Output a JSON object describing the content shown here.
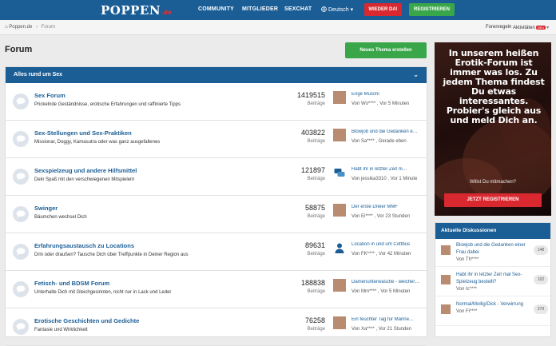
{
  "header": {
    "logo": "POPPEN",
    "logo_tld": ".de",
    "nav": [
      "COMMUNITY",
      "MITGLIEDER",
      "SEXCHAT"
    ],
    "language": "Deutsch",
    "login_label": "WIEDER DA!",
    "register_label": "REGISTRIEREN"
  },
  "breadcrumb": {
    "home": "Poppen.de",
    "current": "Forum"
  },
  "topright": {
    "rules": "Forenregeln",
    "activity": "Aktivitäten",
    "activity_badge": "NEU"
  },
  "page": {
    "title": "Forum",
    "new_thread_label": "Neues Thema erstellen"
  },
  "section": {
    "title": "Alles rund um Sex",
    "count_label": "Beiträge",
    "rows": [
      {
        "name": "Sex Forum",
        "desc": "Prickelnde Geständnisse, erotische Erfahrungen und raffinierte Tipps",
        "count": "1419515",
        "last_title": "Enge Muschi",
        "last_meta": "Von Wo**** , Vor 5 Minuten"
      },
      {
        "name": "Sex-Stellungen und Sex-Praktiken",
        "desc": "Missionar, Doggy, Kamasutra oder was ganz ausgefallenes",
        "count": "403822",
        "last_title": "Blowjob und die Gedanken e…",
        "last_meta": "Von Sa**** , Gerade eben"
      },
      {
        "name": "Sexspielzeug und andere Hilfsmittel",
        "desc": "Dein Spaß mit den verschwiegenen Mitspielern",
        "count": "121897",
        "last_title": "Habt ihr in letzter Zeit m…",
        "last_meta": "Von jessika3310 , Vor 1 Minute"
      },
      {
        "name": "Swinger",
        "desc": "Bäumchen wechsel Dich",
        "count": "58875",
        "last_title": "Der erste Dreier MMF",
        "last_meta": "Von Ei**** , Vor 23 Stunden"
      },
      {
        "name": "Erfahrungsaustausch zu Locations",
        "desc": "Drin oder draußen? Tausche Dich über Treffpunkte in Deiner Region aus",
        "count": "89631",
        "last_title": "Location in und um Cottbus",
        "last_meta": "Von FK**** , Vor 42 Minuten"
      },
      {
        "name": "Fetisch- und BDSM Forum",
        "desc": "Unterhalte Dich mit Gleichgesinnten, nicht nur in Lack und Leder",
        "count": "188838",
        "last_title": "Damenunterwäsche - welcher…",
        "last_meta": "Von Mm**** , Vor 5 Minuten"
      },
      {
        "name": "Erotische Geschichten und Gedichte",
        "desc": "Fantasie und Wirklichkeit",
        "count": "76258",
        "last_title": "Ein feuchter Tag für Männe…",
        "last_meta": "Von Xa**** , Vor 21 Stunden"
      }
    ]
  },
  "ad": {
    "headline": "In unserem heißen Erotik-Forum ist immer was los. Zu jedem Thema findest Du etwas interessantes. Probier's gleich aus und meld Dich an.",
    "question": "Willst Du mitmachen?",
    "cta": "JETZT REGISTRIEREN"
  },
  "sidebar": {
    "title": "Aktuelle Diskussionen",
    "items": [
      {
        "title": "Blowjob und die Gedanken einer Frau dabei",
        "meta": "Von Th****",
        "count": "148"
      },
      {
        "title": "Habt ihr in letzter Zeit mal Sex-Spielzeug bestellt?",
        "meta": "Von Ic****",
        "count": "102"
      },
      {
        "title": "Normal/Mollig/Dick - Verwirrung",
        "meta": "Von Fi****",
        "count": "279"
      }
    ]
  },
  "colors": {
    "primary": "#1b5e96",
    "green": "#3aa64a",
    "red": "#d9282f"
  }
}
